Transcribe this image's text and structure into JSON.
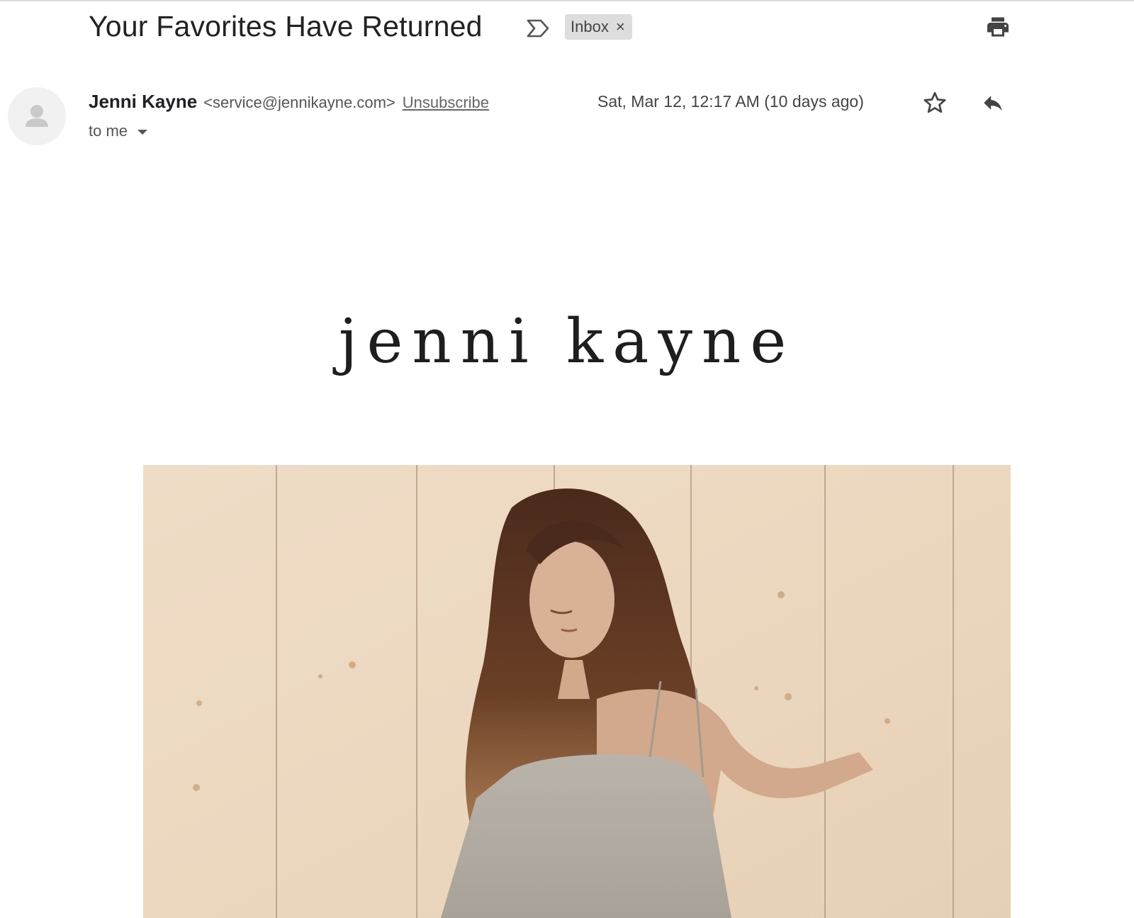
{
  "email": {
    "subject": "Your Favorites Have Returned",
    "label": "Inbox",
    "label_close": "×",
    "sender_name": "Jenni Kayne",
    "sender_email": "<service@jennikayne.com>",
    "unsubscribe": "Unsubscribe",
    "recipient": "to me",
    "date": "Sat, Mar 12, 12:17 AM (10 days ago)"
  },
  "icons": {
    "importance": "importance-marker-icon",
    "print": "printer-icon",
    "avatar": "person-icon",
    "star": "star-outline-icon",
    "reply": "reply-arrow-icon",
    "recipient_menu": "caret-down-icon"
  },
  "body": {
    "brand_logo": "jenni kayne",
    "hero_image": "photo of a woman in a light grey camisole in front of a pale wood plank wall"
  }
}
